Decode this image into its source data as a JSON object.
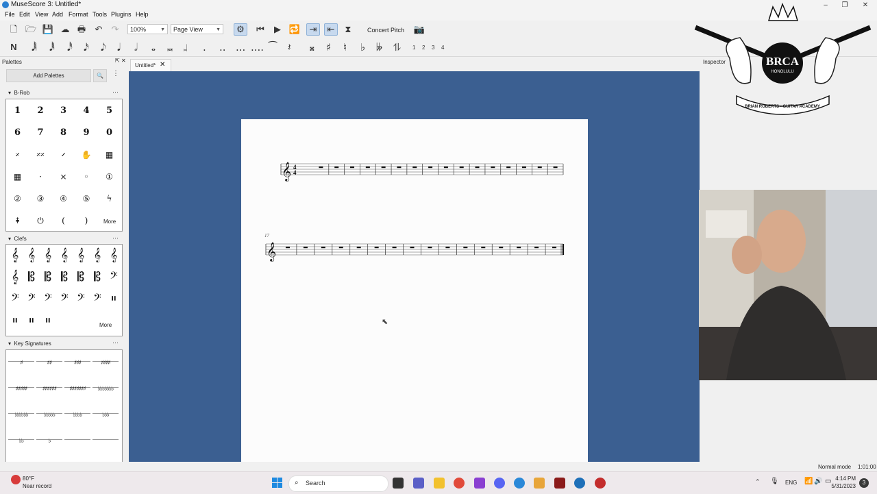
{
  "window": {
    "title": "MuseScore 3: Untitled*"
  },
  "menu": [
    "File",
    "Edit",
    "View",
    "Add",
    "Format",
    "Tools",
    "Plugins",
    "Help"
  ],
  "toolbar": {
    "zoom_value": "100%",
    "view_mode": "Page View",
    "concert_pitch_label": "Concert Pitch",
    "voices": [
      "1",
      "2",
      "3",
      "4"
    ]
  },
  "palettes": {
    "title": "Palettes",
    "add_palettes_label": "Add Palettes",
    "sections": [
      {
        "name": "B-Rob",
        "cells": [
          "1",
          "2",
          "3",
          "4",
          "5",
          "6",
          "7",
          "8",
          "9",
          "0",
          "𝄎",
          "𝄎𝄎",
          "𝄍",
          "✋",
          "▦",
          "▦",
          "·",
          "×",
          "◦",
          "①",
          "②",
          "③",
          "④",
          "⑤",
          "ϟ",
          "⇞",
          "⏻",
          "(",
          ")"
        ],
        "more_label": "More"
      },
      {
        "name": "Clefs",
        "more_label": "More"
      },
      {
        "name": "Key Signatures"
      }
    ]
  },
  "tabs": [
    {
      "label": "Untitled*"
    }
  ],
  "score": {
    "measure_number_second_system": "17"
  },
  "inspector": {
    "title": "Inspector"
  },
  "watermark": {
    "text": "BRCA HONOLULU",
    "banner": "BRIAN ROBERTS GUITAR ACADEMY"
  },
  "status": {
    "mode": "Normal mode",
    "position": "1:01:00"
  },
  "taskbar": {
    "weather_temp": "80°F",
    "weather_desc": "Near record",
    "search_placeholder": "Search",
    "language": "ENG",
    "time": "4:14 PM",
    "date": "5/31/2023",
    "notification_count": "3"
  }
}
